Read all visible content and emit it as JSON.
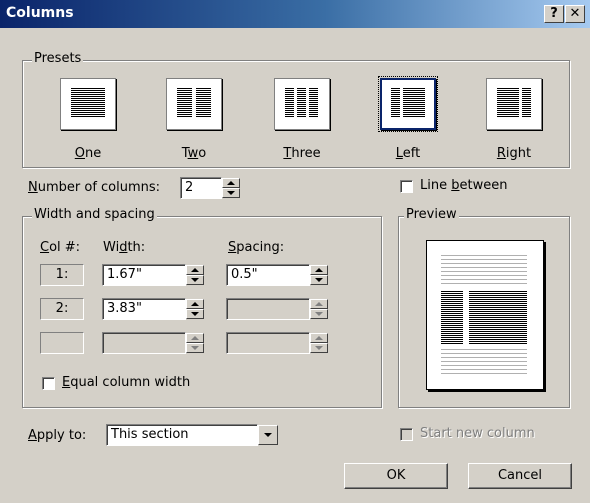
{
  "window": {
    "title": "Columns",
    "help_label": "?",
    "close_label": "✕"
  },
  "presets": {
    "group_label": "Presets",
    "items": [
      {
        "label": "One",
        "key": "O",
        "rest": "ne",
        "pre": ""
      },
      {
        "label": "Two",
        "pre": "T",
        "key": "w",
        "rest": "o"
      },
      {
        "label": "Three",
        "pre": "",
        "key": "T",
        "rest": "hree"
      },
      {
        "label": "Left",
        "pre": "",
        "key": "L",
        "rest": "eft"
      },
      {
        "label": "Right",
        "pre": "",
        "key": "R",
        "rest": "ight"
      }
    ],
    "selected": "Left"
  },
  "number_of_columns": {
    "label_key": "N",
    "label_rest": "umber of columns:",
    "value": "2"
  },
  "line_between": {
    "label_pre": "Line ",
    "label_key": "b",
    "label_rest": "etween",
    "checked": false
  },
  "width_spacing": {
    "group_label": "Width and spacing",
    "col_header_key": "C",
    "col_header_rest": "ol #:",
    "width_header_pre": "Wi",
    "width_header_key": "d",
    "width_header_rest": "th:",
    "spacing_header_key": "S",
    "spacing_header_rest": "pacing:",
    "rows": [
      {
        "col": "1:",
        "width": "1.67\"",
        "spacing": "0.5\""
      },
      {
        "col": "2:",
        "width": "3.83\"",
        "spacing": ""
      },
      {
        "col": "",
        "width": "",
        "spacing": ""
      }
    ]
  },
  "equal_width": {
    "label_key": "E",
    "label_rest": "qual column width",
    "checked": false
  },
  "preview": {
    "group_label": "Preview"
  },
  "apply_to": {
    "label_key": "A",
    "label_rest": "pply to:",
    "value": "This section"
  },
  "start_new_column": {
    "label": "Start new column",
    "checked": false
  },
  "buttons": {
    "ok": "OK",
    "cancel": "Cancel"
  }
}
